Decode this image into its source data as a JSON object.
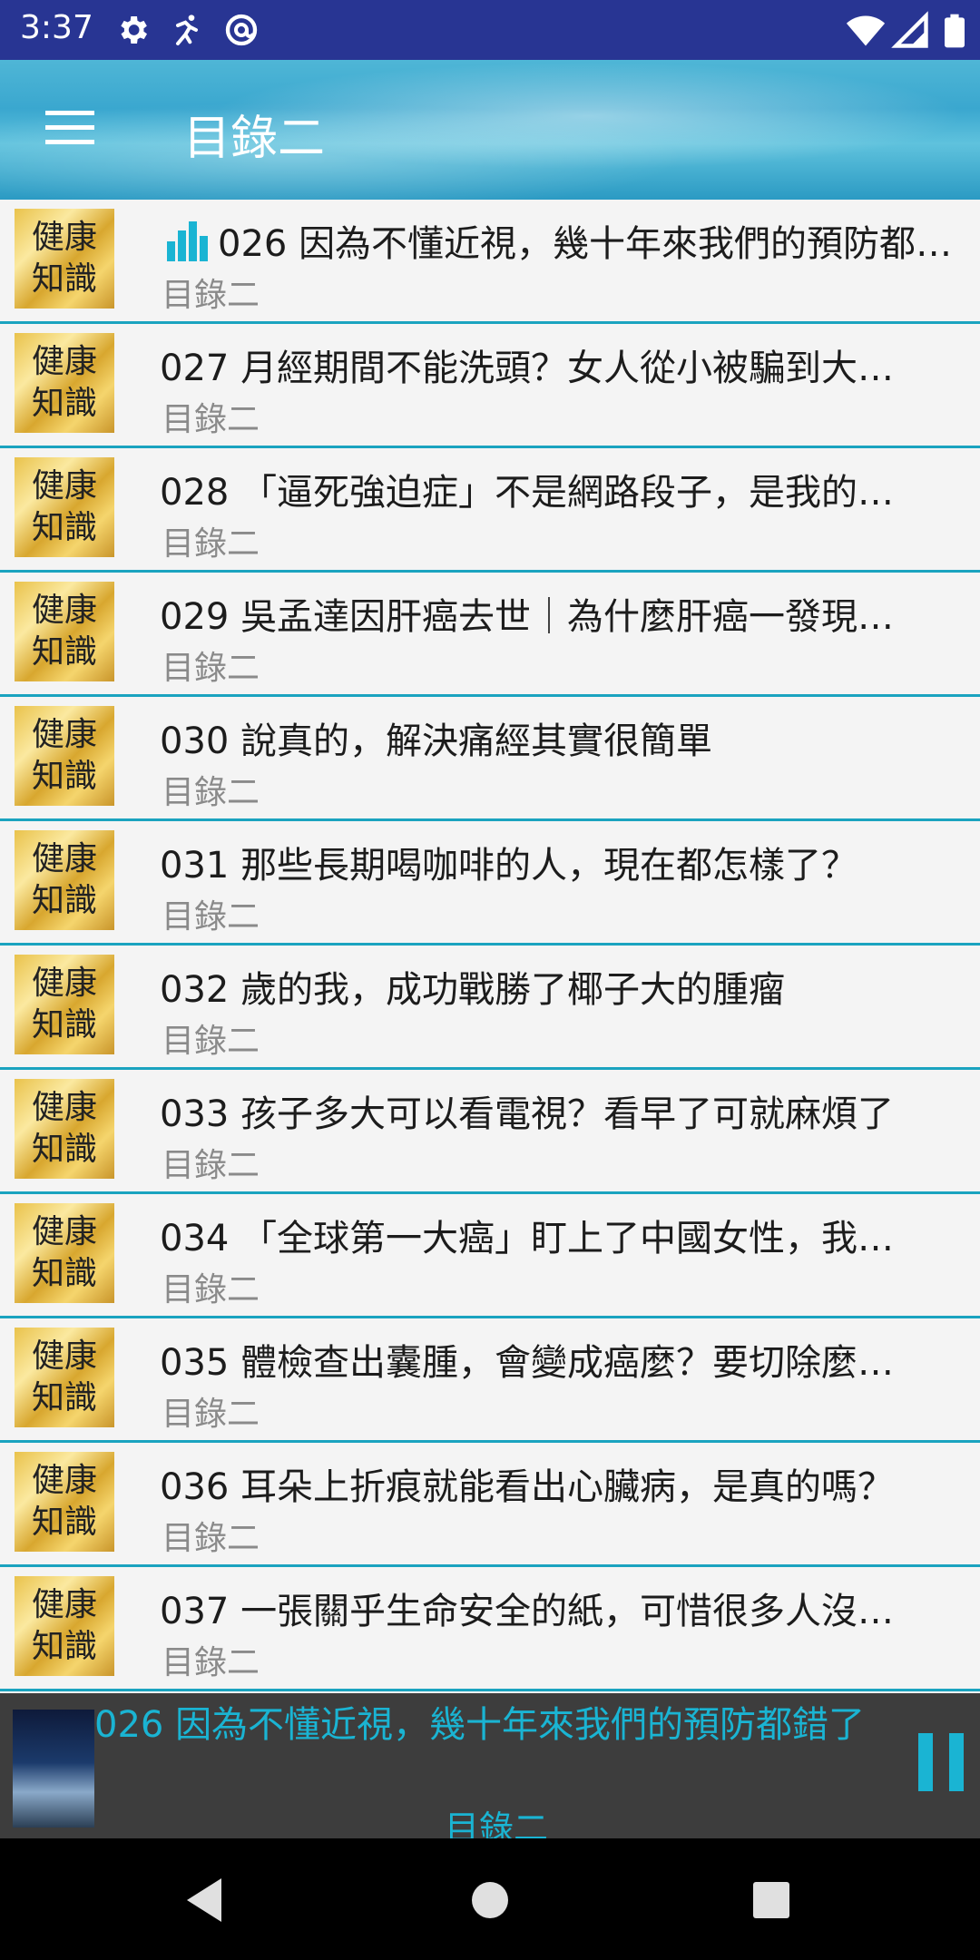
{
  "status_bar": {
    "time": "3:37",
    "left_icons": [
      "settings-icon",
      "runner-icon",
      "at-sign-icon"
    ],
    "right_icons": [
      "wifi-icon",
      "signal-icon",
      "battery-icon"
    ]
  },
  "toolbar": {
    "title": "目錄二",
    "menu_icon": "hamburger-menu-icon"
  },
  "list": {
    "items": [
      {
        "thumb_line1": "健康",
        "thumb_line2": "知識",
        "title": "026 因為不懂近視，幾十年來我們的預防都錯了",
        "subtitle": "目錄二",
        "playing": true
      },
      {
        "thumb_line1": "健康",
        "thumb_line2": "知識",
        "title": "027 月經期間不能洗頭？女人從小被騙到大…",
        "subtitle": "目錄二",
        "playing": false
      },
      {
        "thumb_line1": "健康",
        "thumb_line2": "知識",
        "title": "028 「逼死強迫症」不是網路段子，是我的…",
        "subtitle": "目錄二",
        "playing": false
      },
      {
        "thumb_line1": "健康",
        "thumb_line2": "知識",
        "title": "029 吳孟達因肝癌去世｜為什麼肝癌一發現…",
        "subtitle": "目錄二",
        "playing": false
      },
      {
        "thumb_line1": "健康",
        "thumb_line2": "知識",
        "title": "030 說真的，解決痛經其實很簡單",
        "subtitle": "目錄二",
        "playing": false
      },
      {
        "thumb_line1": "健康",
        "thumb_line2": "知識",
        "title": "031 那些長期喝咖啡的人，現在都怎樣了？",
        "subtitle": "目錄二",
        "playing": false
      },
      {
        "thumb_line1": "健康",
        "thumb_line2": "知識",
        "title": "032 歲的我，成功戰勝了椰子大的腫瘤",
        "subtitle": "目錄二",
        "playing": false
      },
      {
        "thumb_line1": "健康",
        "thumb_line2": "知識",
        "title": "033 孩子多大可以看電視？看早了可就麻煩了",
        "subtitle": "目錄二",
        "playing": false
      },
      {
        "thumb_line1": "健康",
        "thumb_line2": "知識",
        "title": "034 「全球第一大癌」盯上了中國女性，我…",
        "subtitle": "目錄二",
        "playing": false
      },
      {
        "thumb_line1": "健康",
        "thumb_line2": "知識",
        "title": "035 體檢查出囊腫，會變成癌麼？要切除麼…",
        "subtitle": "目錄二",
        "playing": false
      },
      {
        "thumb_line1": "健康",
        "thumb_line2": "知識",
        "title": "036 耳朵上折痕就能看出心臟病，是真的嗎？",
        "subtitle": "目錄二",
        "playing": false
      },
      {
        "thumb_line1": "健康",
        "thumb_line2": "知識",
        "title": "037 一張關乎生命安全的紙，可惜很多人沒…",
        "subtitle": "目錄二",
        "playing": false
      }
    ]
  },
  "player": {
    "title": "026 因為不懂近視，幾十年來我們的預防都錯了",
    "subtitle": "目錄二",
    "state_icon": "pause-icon"
  },
  "nav_bar": {
    "buttons": [
      "back-icon",
      "home-icon",
      "recents-icon"
    ]
  },
  "colors": {
    "status_bar": "#283593",
    "accent": "#1aa3bf",
    "player_text": "#1ab4d3",
    "player_bg": "#3d3d3d"
  }
}
